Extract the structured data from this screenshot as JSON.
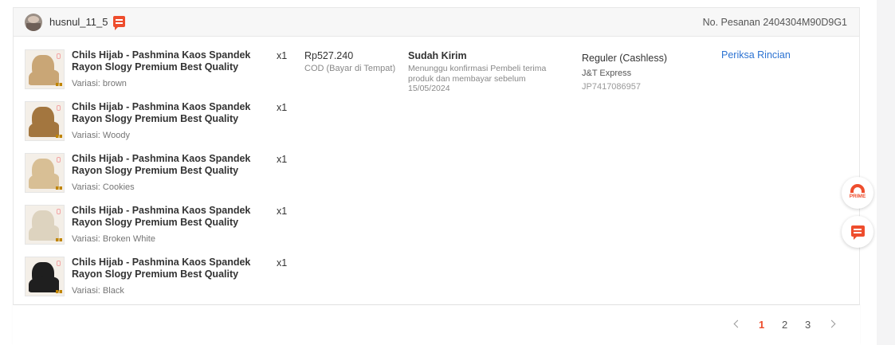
{
  "order": {
    "buyer_name": "husnul_11_5",
    "order_number": "No. Pesanan 2404304M90D9G1",
    "price": "Rp527.240",
    "payment_method": "COD (Bayar di Tempat)",
    "status": "Sudah Kirim",
    "status_description": "Menunggu konfirmasi Pembeli terima produk dan membayar sebelum 15/05/2024",
    "shipping_service": "Reguler (Cashless)",
    "courier": "J&T Express",
    "tracking_number": "JP7417086957",
    "detail_link": "Periksa Rincian",
    "items": [
      {
        "title": "Chils Hijab - Pashmina Kaos Spandek Rayon Slogy Premium Best Quality",
        "qty": "x1",
        "variant": "Variasi: brown",
        "color": "#c9a676"
      },
      {
        "title": "Chils Hijab - Pashmina Kaos Spandek Rayon Slogy Premium Best Quality",
        "qty": "x1",
        "variant": "Variasi: Woody",
        "color": "#a3763f"
      },
      {
        "title": "Chils Hijab - Pashmina Kaos Spandek Rayon Slogy Premium Best Quality",
        "qty": "x1",
        "variant": "Variasi: Cookies",
        "color": "#d8bf95"
      },
      {
        "title": "Chils Hijab - Pashmina Kaos Spandek Rayon Slogy Premium Best Quality",
        "qty": "x1",
        "variant": "Variasi: Broken White",
        "color": "#ddd3bf"
      },
      {
        "title": "Chils Hijab - Pashmina Kaos Spandek Rayon Slogy Premium Best Quality",
        "qty": "x1",
        "variant": "Variasi: Black",
        "color": "#1f1f1f"
      }
    ]
  },
  "pagination": {
    "pages": [
      "1",
      "2",
      "3"
    ],
    "current": "1"
  },
  "floating": {
    "prime_label": "PRIME"
  },
  "colors": {
    "accent": "#ee4d2d",
    "link": "#2c73d2"
  },
  "icons": {
    "chat": "chat-icon",
    "prime": "prime-icon",
    "prev": "chevron-left-icon",
    "next": "chevron-right-icon"
  }
}
